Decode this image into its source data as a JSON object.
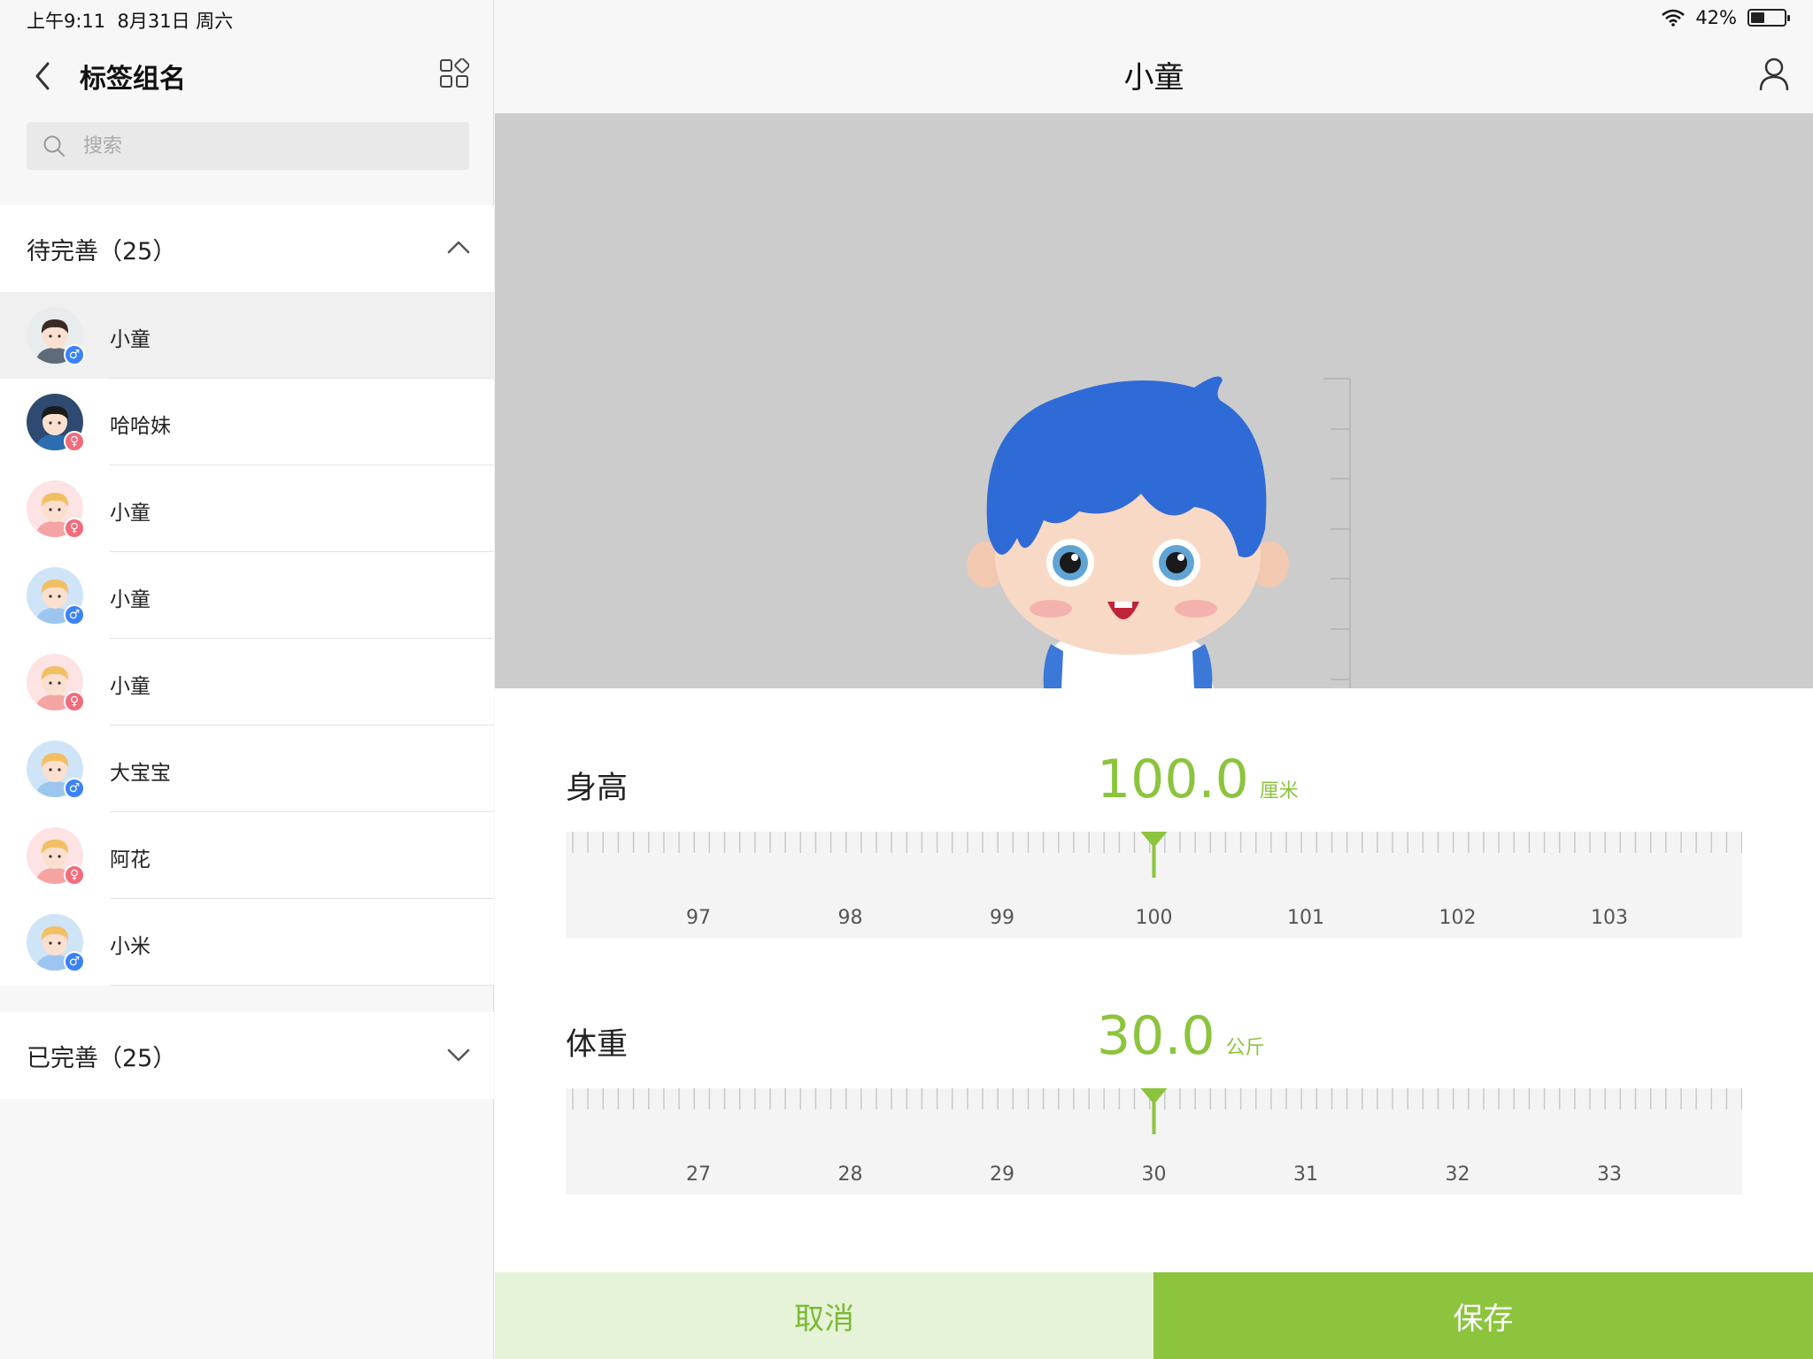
{
  "status": {
    "time": "上午9:11",
    "date": "8月31日 周六",
    "battery": "42%",
    "battery_level": 0.42
  },
  "sidebar": {
    "title": "标签组名",
    "search_placeholder": "搜索",
    "pending_group": {
      "label": "待完善（25）"
    },
    "done_group": {
      "label": "已完善（25）"
    },
    "items": [
      {
        "name": "小童",
        "gender": "male",
        "avatar": "photo-boy",
        "selected": true
      },
      {
        "name": "哈哈妹",
        "gender": "female",
        "avatar": "photo-girl"
      },
      {
        "name": "小童",
        "gender": "female",
        "avatar": "cartoon-girl"
      },
      {
        "name": "小童",
        "gender": "male",
        "avatar": "cartoon-boy"
      },
      {
        "name": "小童",
        "gender": "female",
        "avatar": "cartoon-girl"
      },
      {
        "name": "大宝宝",
        "gender": "male",
        "avatar": "cartoon-boy"
      },
      {
        "name": "阿花",
        "gender": "female",
        "avatar": "cartoon-girl"
      },
      {
        "name": "小米",
        "gender": "male",
        "avatar": "cartoon-boy"
      }
    ],
    "gender_symbols": {
      "male": "♂",
      "female": "♀"
    }
  },
  "detail": {
    "title": "小童",
    "height": {
      "label": "身高",
      "value": "100.0",
      "unit": "厘米",
      "ticks": [
        "97",
        "98",
        "99",
        "100",
        "101",
        "102",
        "103"
      ]
    },
    "weight": {
      "label": "体重",
      "value": "30.0",
      "unit": "公斤",
      "ticks": [
        "27",
        "28",
        "29",
        "30",
        "31",
        "32",
        "33"
      ]
    },
    "cancel_label": "取消",
    "save_label": "保存"
  },
  "colors": {
    "accent": "#8cc43e",
    "accent_light": "#e6f3d8",
    "male": "#3b82f6",
    "female": "#f26b7a"
  }
}
